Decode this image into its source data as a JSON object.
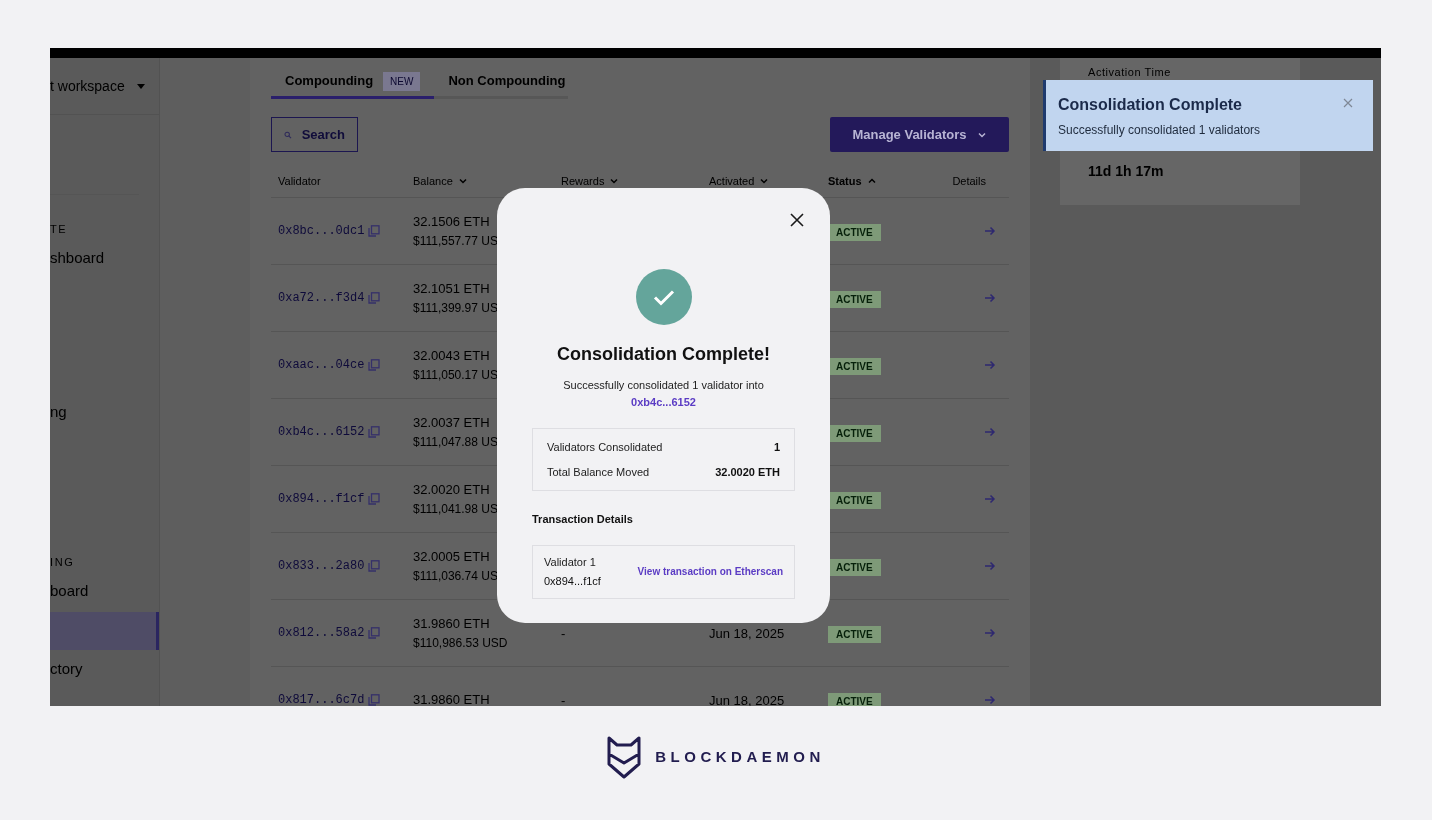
{
  "sidebar": {
    "workspace": "t workspace",
    "sections": [
      {
        "label": "TE",
        "items": [
          {
            "label": "shboard",
            "selected": false
          },
          {
            "label": "ng",
            "selected": false
          }
        ]
      },
      {
        "label": "ING",
        "items": [
          {
            "label": "board",
            "selected": false
          },
          {
            "selected": true
          },
          {
            "label": "ctory",
            "selected": false
          }
        ]
      }
    ]
  },
  "tabs": [
    {
      "label": "Compounding",
      "badge": "NEW",
      "selected": true
    },
    {
      "label": "Non Compounding",
      "selected": false
    }
  ],
  "search": {
    "label": "Search"
  },
  "manage_button": {
    "label": "Manage Validators"
  },
  "table": {
    "columns": [
      {
        "label": "Validator",
        "sortable": false,
        "active": false
      },
      {
        "label": "Balance",
        "sortable": true,
        "ascending": false,
        "active": false
      },
      {
        "label": "Rewards",
        "sortable": true,
        "ascending": false,
        "active": false
      },
      {
        "label": "Activated",
        "sortable": true,
        "ascending": false,
        "active": false
      },
      {
        "label": "Status",
        "sortable": true,
        "ascending": true,
        "active": true
      },
      {
        "label": "Details",
        "sortable": false,
        "active": false
      }
    ],
    "rows": [
      {
        "validator": "0x8bc...0dc1",
        "eth": "32.1506 ETH",
        "usd": "$111,557.77 US",
        "status": "ACTIVE"
      },
      {
        "validator": "0xa72...f3d4",
        "eth": "32.1051 ETH",
        "usd": "$111,399.97 US",
        "status": "ACTIVE"
      },
      {
        "validator": "0xaac...04ce",
        "eth": "32.0043 ETH",
        "usd": "$111,050.17 US",
        "status": "ACTIVE"
      },
      {
        "validator": "0xb4c...6152",
        "eth": "32.0037 ETH",
        "usd": "$111,047.88 US",
        "status": "ACTIVE"
      },
      {
        "validator": "0x894...f1cf",
        "eth": "32.0020 ETH",
        "usd": "$111,041.98 US",
        "status": "ACTIVE"
      },
      {
        "validator": "0x833...2a80",
        "eth": "32.0005 ETH",
        "usd": "$111,036.74 US",
        "status": "ACTIVE"
      },
      {
        "validator": "0x812...58a2",
        "eth": "31.9860 ETH",
        "usd": "$110,986.53 USD",
        "rewards": "-",
        "activated": "Jun 18, 2025",
        "status": "ACTIVE"
      },
      {
        "validator": "0x817...6c7d",
        "eth": "31.9860 ETH",
        "rewards": "-",
        "activated": "Jun 18, 2025",
        "status": "ACTIVE"
      }
    ]
  },
  "info_card": {
    "label": "Activation Time",
    "value": "11d 1h 17m"
  },
  "toast": {
    "title": "Consolidation Complete",
    "message": "Successfully consolidated 1 validators"
  },
  "modal": {
    "title": "Consolidation Complete!",
    "message": "Successfully consolidated 1 validator into",
    "target": "0xb4c...6152",
    "summary": [
      {
        "label": "Validators Consolidated",
        "value": "1"
      },
      {
        "label": "Total Balance Moved",
        "value": "32.0020 ETH"
      }
    ],
    "section_title": "Transaction Details",
    "transactions": [
      {
        "label": "Validator 1",
        "address": "0x894...f1cf",
        "link": "View transaction on Etherscan"
      }
    ]
  },
  "brand": {
    "name": "BLOCKDAEMON"
  }
}
